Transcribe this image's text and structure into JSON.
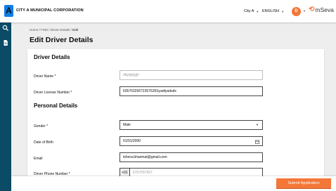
{
  "header": {
    "logo_letter": "A",
    "org_name": "CITY A MUNICIPAL CORPORATION",
    "city_select": "City A",
    "language_select": "ENGLISH",
    "avatar_initial": "D",
    "brand_name": "mSeva"
  },
  "breadcrumb": {
    "items": [
      "Home",
      "FSM",
      "Driver Details",
      "Edit"
    ],
    "separator": " / "
  },
  "page_title": "Edit Driver Details",
  "driver_section": {
    "title": "Driver Details",
    "name_label": "Driver Name *",
    "name_value": "dfgdghjgjh",
    "license_label": "Driver License Number *",
    "license_value": "63576325672357635Syadtyadsds"
  },
  "personal_section": {
    "title": "Personal Details",
    "gender_label": "Gender *",
    "gender_value": "Male",
    "dob_label": "Date of Birth",
    "dob_value": "01/01/2000",
    "email_label": "Email",
    "email_value": "tshera.bhanmat@gmail.com",
    "phone_label": "Driver Phone Number *",
    "phone_prefix": "+91",
    "phone_value": "6757657657"
  },
  "footer": {
    "submit_label": "Submit Application"
  },
  "colors": {
    "accent": "#f47738",
    "sidebar": "#0b4b66",
    "logo": "#0d7ee8"
  },
  "icons": [
    "search-icon",
    "document-icon",
    "calendar-icon",
    "chevron-down-icon"
  ]
}
